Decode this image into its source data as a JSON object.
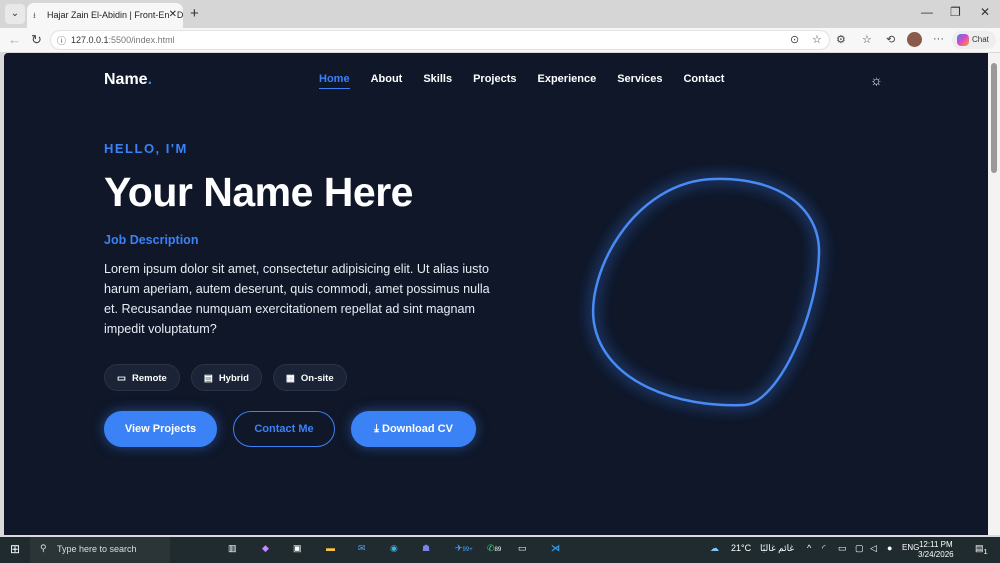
{
  "browser": {
    "tab_title": "Hajar Zain El-Abidin | Front-End De",
    "url_host": "127.0.0.1",
    "url_rest": ":5500/index.html",
    "chat_label": "Chat"
  },
  "site": {
    "brand": "Name",
    "brand_dot": ".",
    "nav": [
      {
        "label": "Home",
        "active": true
      },
      {
        "label": "About"
      },
      {
        "label": "Skills"
      },
      {
        "label": "Projects"
      },
      {
        "label": "Experience"
      },
      {
        "label": "Services"
      },
      {
        "label": "Contact"
      }
    ],
    "hello": "HELLO, I'M",
    "name": "Your Name Here",
    "job": "Job Description",
    "description": "Lorem ipsum dolor sit amet, consectetur adipisicing elit. Ut alias iusto harum aperiam, autem deserunt, quis commodi, amet possimus nulla et. Recusandae numquam exercitationem repellat ad sint magnam impedit voluptatum?",
    "chips": [
      {
        "icon": "laptop-icon",
        "glyph": "▭",
        "label": "Remote"
      },
      {
        "icon": "building-icon",
        "glyph": "▤",
        "label": "Hybrid"
      },
      {
        "icon": "office-icon",
        "glyph": "▦",
        "label": "On-site"
      }
    ],
    "buttons": {
      "projects": "View Projects",
      "contact": "Contact Me",
      "download": "Download CV",
      "download_glyph": "⤓"
    },
    "accent": "#3b82f6",
    "background": "#0f1729"
  },
  "taskbar": {
    "search_placeholder": "Type here to search",
    "weather": "21°C",
    "weather_text": "غائم غالبًا",
    "lang": "ENG",
    "time": "12:11 PM",
    "date": "3/24/2026",
    "badge_telegram": "99+",
    "badge_whatsapp": "89",
    "notif": "1"
  }
}
